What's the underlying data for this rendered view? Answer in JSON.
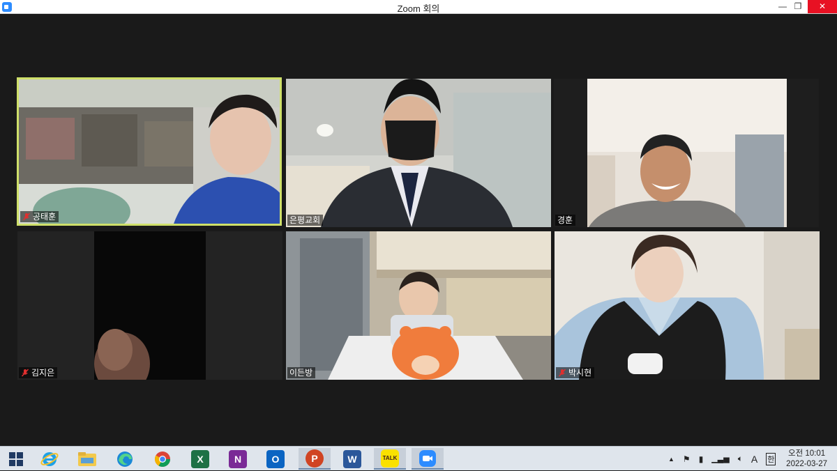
{
  "window": {
    "title": "Zoom 회의"
  },
  "participants": [
    {
      "name": "공태훈",
      "muted": true,
      "active": true
    },
    {
      "name": "은평교회",
      "muted": false,
      "active": false
    },
    {
      "name": "경훈",
      "muted": false,
      "active": false
    },
    {
      "name": "김지은",
      "muted": true,
      "active": false
    },
    {
      "name": "이든방",
      "muted": false,
      "active": false
    },
    {
      "name": "박시현",
      "muted": true,
      "active": false
    }
  ],
  "taskbar": {
    "apps": [
      "windows-start",
      "internet-explorer",
      "file-explorer",
      "edge",
      "chrome",
      "excel",
      "onenote",
      "outlook",
      "powerpoint",
      "word",
      "kakaotalk",
      "zoom"
    ],
    "app_letters": {
      "excel": "X",
      "onenote": "N",
      "outlook": "O",
      "powerpoint": "P",
      "word": "W",
      "kakaotalk": "TALK"
    },
    "ime_a": "A",
    "ime_han": "한",
    "clock_time": "오전 10:01",
    "clock_date": "2022-03-27"
  },
  "colors": {
    "active_speaker_border": "#cfe06a",
    "close_button": "#e81123",
    "zoom_blue": "#2d8cff",
    "mute_red": "#e02f2f"
  }
}
